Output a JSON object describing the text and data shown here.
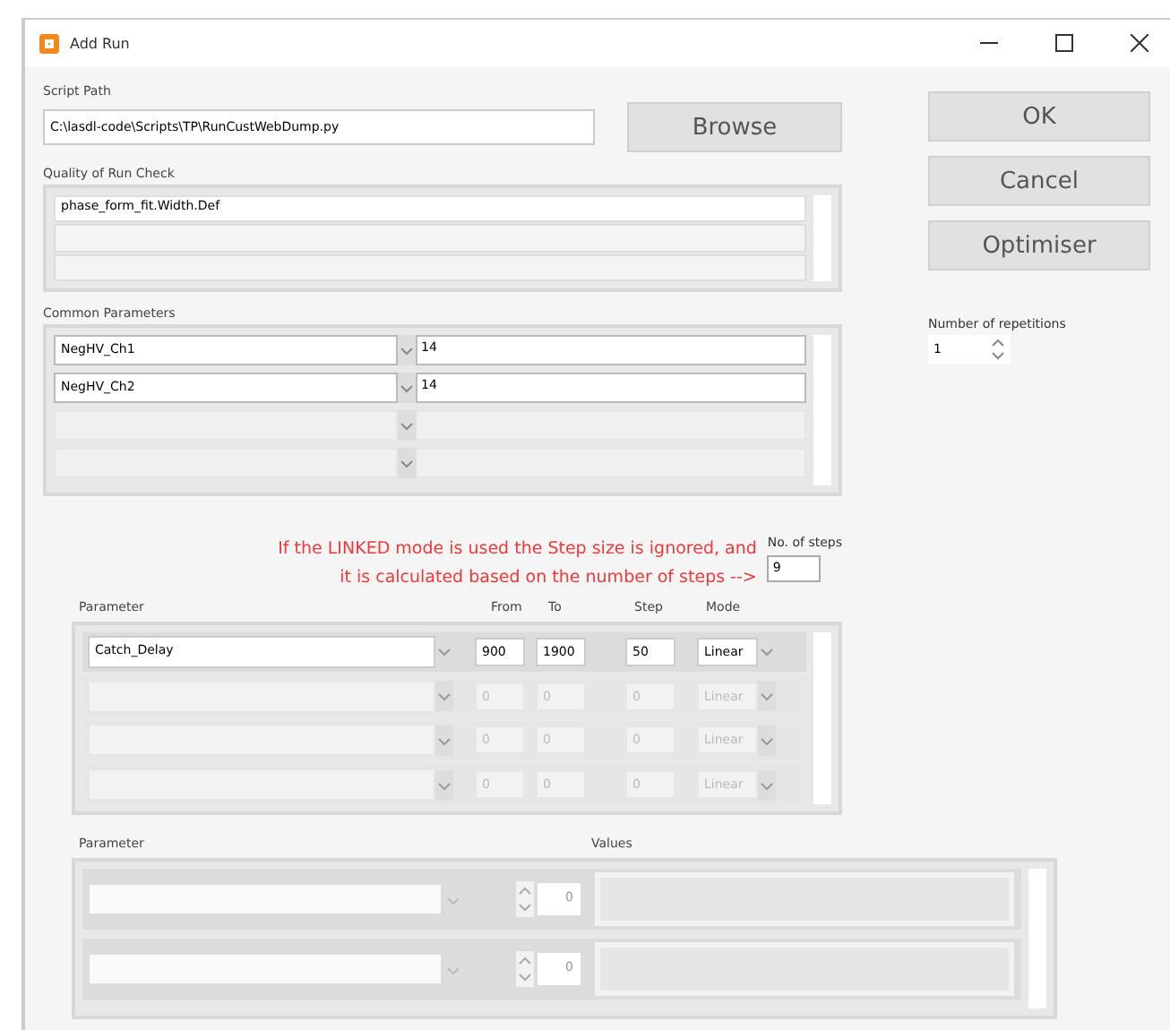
{
  "window": {
    "title": "Add Run"
  },
  "script_path": {
    "label": "Script Path",
    "value": "C:\\lasdl-code\\Scripts\\TP\\RunCustWebDump.py",
    "browse": "Browse"
  },
  "quality_check": {
    "label": "Quality of Run Check",
    "lines": [
      "phase_form_fit.Width.Def"
    ]
  },
  "common_parameters": {
    "label": "Common Parameters",
    "rows": [
      {
        "name": "NegHV_Ch1",
        "value": "14",
        "enabled": true
      },
      {
        "name": "NegHV_Ch2",
        "value": "14",
        "enabled": true
      },
      {
        "name": "",
        "value": "",
        "enabled": false
      },
      {
        "name": "",
        "value": "",
        "enabled": false
      }
    ]
  },
  "buttons": [
    "OK",
    "Cancel",
    "Optimiser"
  ],
  "repetitions": {
    "label": "Number of repetitions",
    "value": "1"
  },
  "note": [
    "If the LINKED mode is used the Step size is ignored, and",
    "it is calculated based on the number of steps -->"
  ],
  "steps": {
    "label": "No. of steps",
    "value": "9"
  },
  "scan": {
    "columns": [
      "Parameter",
      "From",
      "To",
      "Step",
      "Mode"
    ],
    "rows": [
      {
        "parameter": "Catch_Delay",
        "from": "900",
        "to": "1900",
        "step": "50",
        "mode": "Linear",
        "enabled": true
      },
      {
        "parameter": "",
        "from": "0",
        "to": "0",
        "step": "0",
        "mode": "Linear",
        "enabled": false
      },
      {
        "parameter": "",
        "from": "0",
        "to": "0",
        "step": "0",
        "mode": "Linear",
        "enabled": false
      },
      {
        "parameter": "",
        "from": "0",
        "to": "0",
        "step": "0",
        "mode": "Linear",
        "enabled": false
      }
    ]
  },
  "values_table": {
    "columns": [
      "Parameter",
      "Values"
    ],
    "rows": [
      {
        "count": "0"
      },
      {
        "count": "0"
      }
    ]
  }
}
